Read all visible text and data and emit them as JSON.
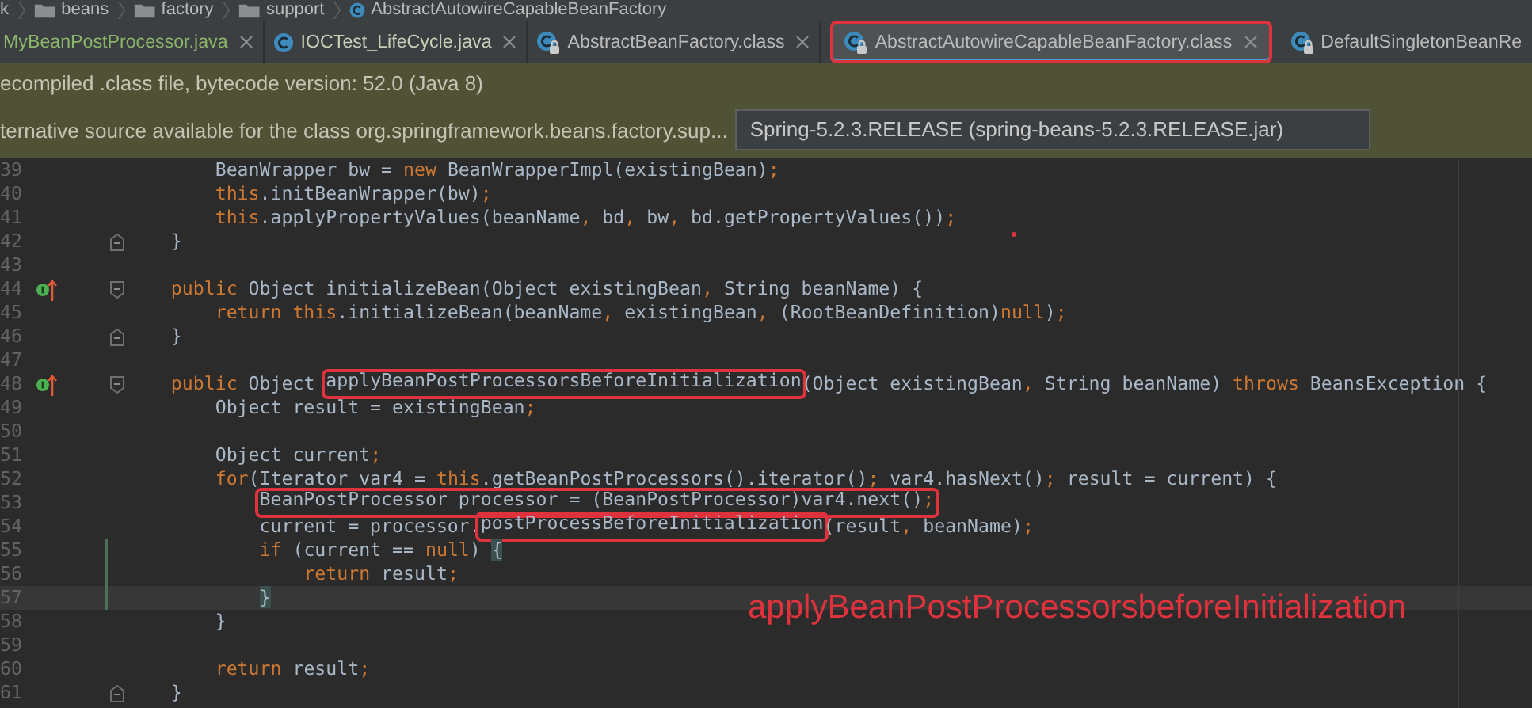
{
  "breadcrumb": [
    {
      "label": "k",
      "kind": "plain"
    },
    {
      "label": "beans",
      "kind": "folder"
    },
    {
      "label": "factory",
      "kind": "folder"
    },
    {
      "label": "support",
      "kind": "folder"
    },
    {
      "label": "AbstractAutowireCapableBeanFactory",
      "kind": "class"
    }
  ],
  "tabs": [
    {
      "label": "MyBeanPostProcessor.java",
      "kind": "plain",
      "color": "#8cb56c",
      "selected": false,
      "closable": true,
      "boxed": false
    },
    {
      "label": "IOCTest_LifeCycle.java",
      "kind": "java",
      "color": "#c7cfb8",
      "selected": false,
      "closable": true,
      "boxed": false
    },
    {
      "label": "AbstractBeanFactory.class",
      "kind": "class",
      "color": "#bbbbbb",
      "selected": false,
      "closable": true,
      "boxed": false
    },
    {
      "label": "AbstractAutowireCapableBeanFactory.class",
      "kind": "class",
      "color": "#bbbbbb",
      "selected": true,
      "closable": true,
      "boxed": true
    },
    {
      "label": "DefaultSingletonBeanRe",
      "kind": "class",
      "color": "#bbbbbb",
      "selected": false,
      "closable": false,
      "boxed": false
    }
  ],
  "notice": {
    "text": "ecompiled .class file, bytecode version: 52.0 (Java 8)"
  },
  "source_notice": {
    "text": "ternative source available for the class org.springframework.beans.factory.sup...",
    "library": "Spring-5.2.3.RELEASE (spring-beans-5.2.3.RELEASE.jar)"
  },
  "code_lines": [
    {
      "number": "39",
      "overrides": false,
      "changed": false,
      "current": false,
      "segments": [
        {
          "boxed": false,
          "tokens": [
            {
              "text": "        BeanWrapper bw = ",
              "kind": "plain"
            },
            {
              "text": "new",
              "kind": "keyword"
            },
            {
              "text": " BeanWrapperImpl(existingBean)",
              "kind": "plain"
            },
            {
              "text": ";",
              "kind": "punct"
            }
          ]
        }
      ]
    },
    {
      "number": "40",
      "overrides": false,
      "changed": false,
      "current": false,
      "segments": [
        {
          "boxed": false,
          "tokens": [
            {
              "text": "        this",
              "kind": "keyword"
            },
            {
              "text": ".initBeanWrapper(bw)",
              "kind": "plain"
            },
            {
              "text": ";",
              "kind": "punct"
            }
          ]
        }
      ]
    },
    {
      "number": "41",
      "overrides": false,
      "changed": false,
      "current": false,
      "segments": [
        {
          "boxed": false,
          "tokens": [
            {
              "text": "        this",
              "kind": "keyword"
            },
            {
              "text": ".applyPropertyValues(beanName",
              "kind": "plain"
            },
            {
              "text": ",",
              "kind": "punct"
            },
            {
              "text": " bd",
              "kind": "plain"
            },
            {
              "text": ",",
              "kind": "punct"
            },
            {
              "text": " bw",
              "kind": "plain"
            },
            {
              "text": ",",
              "kind": "punct"
            },
            {
              "text": " bd.getPropertyValues())",
              "kind": "plain"
            },
            {
              "text": ";",
              "kind": "punct"
            }
          ]
        }
      ]
    },
    {
      "number": "42",
      "overrides": false,
      "changed": false,
      "current": false,
      "fold_close": true,
      "segments": [
        {
          "boxed": false,
          "tokens": [
            {
              "text": "    }",
              "kind": "plain"
            }
          ]
        }
      ]
    },
    {
      "number": "43",
      "overrides": false,
      "changed": false,
      "current": false
    },
    {
      "number": "44",
      "overrides": true,
      "changed": false,
      "current": false,
      "fold_open": true,
      "segments": [
        {
          "boxed": false,
          "tokens": [
            {
              "text": "    public",
              "kind": "keyword"
            },
            {
              "text": " Object initializeBean(Object existingBean",
              "kind": "plain"
            },
            {
              "text": ",",
              "kind": "punct"
            },
            {
              "text": " String beanName) {",
              "kind": "plain"
            }
          ]
        }
      ]
    },
    {
      "number": "45",
      "overrides": false,
      "changed": false,
      "current": false,
      "segments": [
        {
          "boxed": false,
          "tokens": [
            {
              "text": "        return this",
              "kind": "keyword"
            },
            {
              "text": ".initializeBean(beanName",
              "kind": "plain"
            },
            {
              "text": ",",
              "kind": "punct"
            },
            {
              "text": " existingBean",
              "kind": "plain"
            },
            {
              "text": ",",
              "kind": "punct"
            },
            {
              "text": " (RootBeanDefinition)",
              "kind": "plain"
            },
            {
              "text": "null",
              "kind": "keyword"
            },
            {
              "text": ")",
              "kind": "plain"
            },
            {
              "text": ";",
              "kind": "punct"
            }
          ]
        }
      ]
    },
    {
      "number": "46",
      "overrides": false,
      "changed": false,
      "current": false,
      "fold_close": true,
      "segments": [
        {
          "boxed": false,
          "tokens": [
            {
              "text": "    }",
              "kind": "plain"
            }
          ]
        }
      ]
    },
    {
      "number": "47",
      "overrides": false,
      "changed": false,
      "current": false
    },
    {
      "number": "48",
      "overrides": true,
      "changed": false,
      "current": false,
      "fold_open": true,
      "segments": [
        {
          "boxed": false,
          "tokens": [
            {
              "text": "    public",
              "kind": "keyword"
            },
            {
              "text": " Object ",
              "kind": "plain"
            }
          ]
        },
        {
          "boxed": true,
          "tokens": [
            {
              "text": "applyBeanPostProcessorsBeforeInitialization",
              "kind": "plain"
            }
          ]
        },
        {
          "boxed": false,
          "tokens": [
            {
              "text": "(Object existingBean",
              "kind": "plain"
            },
            {
              "text": ",",
              "kind": "punct"
            },
            {
              "text": " String beanName) ",
              "kind": "plain"
            },
            {
              "text": "throws",
              "kind": "keyword"
            },
            {
              "text": " BeansException {",
              "kind": "plain"
            }
          ]
        }
      ]
    },
    {
      "number": "49",
      "overrides": false,
      "changed": false,
      "current": false,
      "segments": [
        {
          "boxed": false,
          "tokens": [
            {
              "text": "        Object result = existingBean",
              "kind": "plain"
            },
            {
              "text": ";",
              "kind": "punct"
            }
          ]
        }
      ]
    },
    {
      "number": "50",
      "overrides": false,
      "changed": false,
      "current": false
    },
    {
      "number": "51",
      "overrides": false,
      "changed": false,
      "current": false,
      "segments": [
        {
          "boxed": false,
          "tokens": [
            {
              "text": "        Object current",
              "kind": "plain"
            },
            {
              "text": ";",
              "kind": "punct"
            }
          ]
        }
      ]
    },
    {
      "number": "52",
      "overrides": false,
      "changed": false,
      "current": false,
      "segments": [
        {
          "boxed": false,
          "tokens": [
            {
              "text": "        for",
              "kind": "keyword"
            },
            {
              "text": "(Iterator var4 = ",
              "kind": "plain"
            },
            {
              "text": "this",
              "kind": "keyword"
            },
            {
              "text": ".getBeanPostProcessors().iterator()",
              "kind": "plain"
            },
            {
              "text": ";",
              "kind": "punct"
            },
            {
              "text": " var4.hasNext()",
              "kind": "plain"
            },
            {
              "text": ";",
              "kind": "punct"
            },
            {
              "text": " result = current) {",
              "kind": "plain"
            }
          ]
        }
      ]
    },
    {
      "number": "53",
      "overrides": false,
      "changed": false,
      "current": false,
      "segments": [
        {
          "boxed": true,
          "tokens": [
            {
              "text": "            BeanPostProcessor processor = (BeanPostProcessor)var4.next()",
              "kind": "plain"
            },
            {
              "text": ";",
              "kind": "punct"
            }
          ]
        }
      ]
    },
    {
      "number": "54",
      "overrides": false,
      "changed": false,
      "current": false,
      "segments": [
        {
          "boxed": false,
          "tokens": [
            {
              "text": "            current = processor.",
              "kind": "plain"
            }
          ]
        },
        {
          "boxed": true,
          "tokens": [
            {
              "text": "postProcessBeforeInitialization",
              "kind": "plain"
            }
          ]
        },
        {
          "boxed": false,
          "tokens": [
            {
              "text": "(result",
              "kind": "plain"
            },
            {
              "text": ",",
              "kind": "punct"
            },
            {
              "text": " beanName)",
              "kind": "plain"
            },
            {
              "text": ";",
              "kind": "punct"
            }
          ]
        }
      ]
    },
    {
      "number": "55",
      "overrides": false,
      "changed": true,
      "current": false,
      "segments": [
        {
          "boxed": false,
          "tokens": [
            {
              "text": "            if",
              "kind": "keyword"
            },
            {
              "text": " (current == ",
              "kind": "plain"
            },
            {
              "text": "null",
              "kind": "keyword"
            },
            {
              "text": ") ",
              "kind": "plain"
            },
            {
              "text": "{",
              "kind": "brace"
            }
          ]
        }
      ]
    },
    {
      "number": "56",
      "overrides": false,
      "changed": true,
      "current": false,
      "segments": [
        {
          "boxed": false,
          "tokens": [
            {
              "text": "                return",
              "kind": "keyword"
            },
            {
              "text": " result",
              "kind": "plain"
            },
            {
              "text": ";",
              "kind": "punct"
            }
          ]
        }
      ]
    },
    {
      "number": "57",
      "overrides": false,
      "changed": true,
      "current": true,
      "segments": [
        {
          "boxed": false,
          "tokens": [
            {
              "text": "            }",
              "kind": "brace"
            }
          ]
        }
      ]
    },
    {
      "number": "58",
      "overrides": false,
      "changed": false,
      "current": false,
      "segments": [
        {
          "boxed": false,
          "tokens": [
            {
              "text": "        }",
              "kind": "plain"
            }
          ]
        }
      ]
    },
    {
      "number": "59",
      "overrides": false,
      "changed": false,
      "current": false
    },
    {
      "number": "60",
      "overrides": false,
      "changed": false,
      "current": false,
      "segments": [
        {
          "boxed": false,
          "tokens": [
            {
              "text": "        return",
              "kind": "keyword"
            },
            {
              "text": " result",
              "kind": "plain"
            },
            {
              "text": ";",
              "kind": "punct"
            }
          ]
        }
      ]
    },
    {
      "number": "61",
      "overrides": false,
      "changed": false,
      "current": false,
      "fold_close": true,
      "segments": [
        {
          "boxed": false,
          "tokens": [
            {
              "text": "    }",
              "kind": "plain"
            }
          ]
        }
      ]
    }
  ],
  "annotation": {
    "text": "applyBeanPostProcessorsbeforeInitialization"
  }
}
